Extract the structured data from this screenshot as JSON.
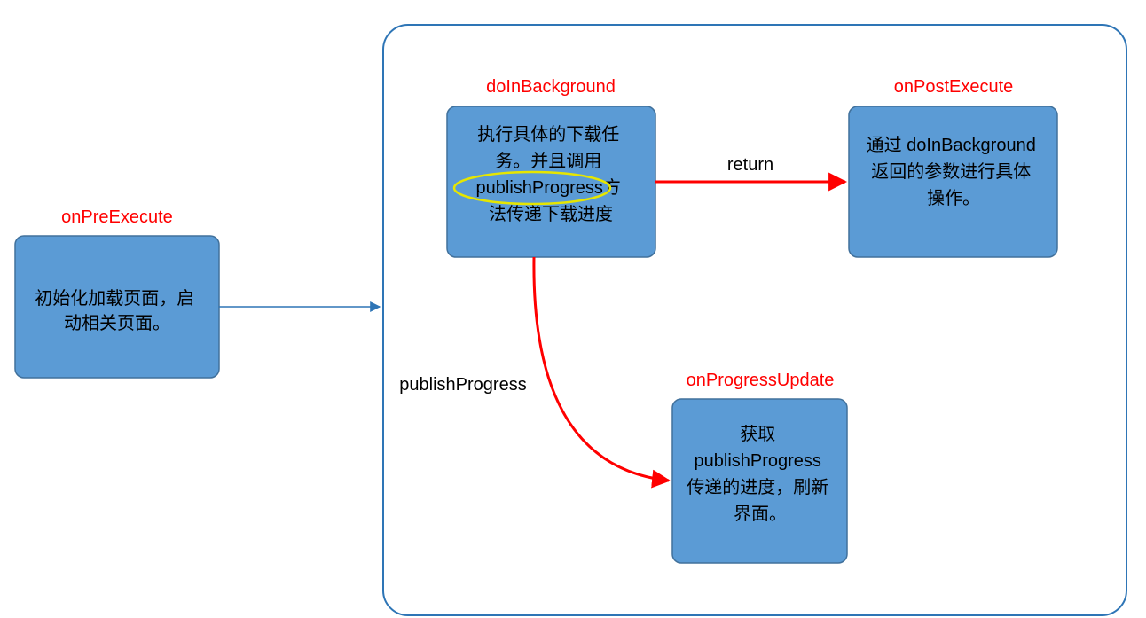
{
  "nodes": {
    "onPreExecute": {
      "title": "onPreExecute",
      "line1": "初始化加载页面，启",
      "line2": "动相关页面。"
    },
    "doInBackground": {
      "title": "doInBackground",
      "line1": "执行具体的下载任",
      "line2": "务。并且调用",
      "line3_a": "publishProgress",
      "line3_b": "方",
      "line4": "法传递下载进度"
    },
    "onPostExecute": {
      "title": "onPostExecute",
      "line1": "通过 doInBackground",
      "line2": "返回的参数进行具体",
      "line3": "操作。"
    },
    "onProgressUpdate": {
      "title": "onProgressUpdate",
      "line1": "获取",
      "line2": "publishProgress",
      "line3": "传递的进度，刷新",
      "line4": "界面。"
    }
  },
  "edges": {
    "return": "return",
    "publishProgress": "publishProgress"
  },
  "highlighted_term": "publishProgress"
}
